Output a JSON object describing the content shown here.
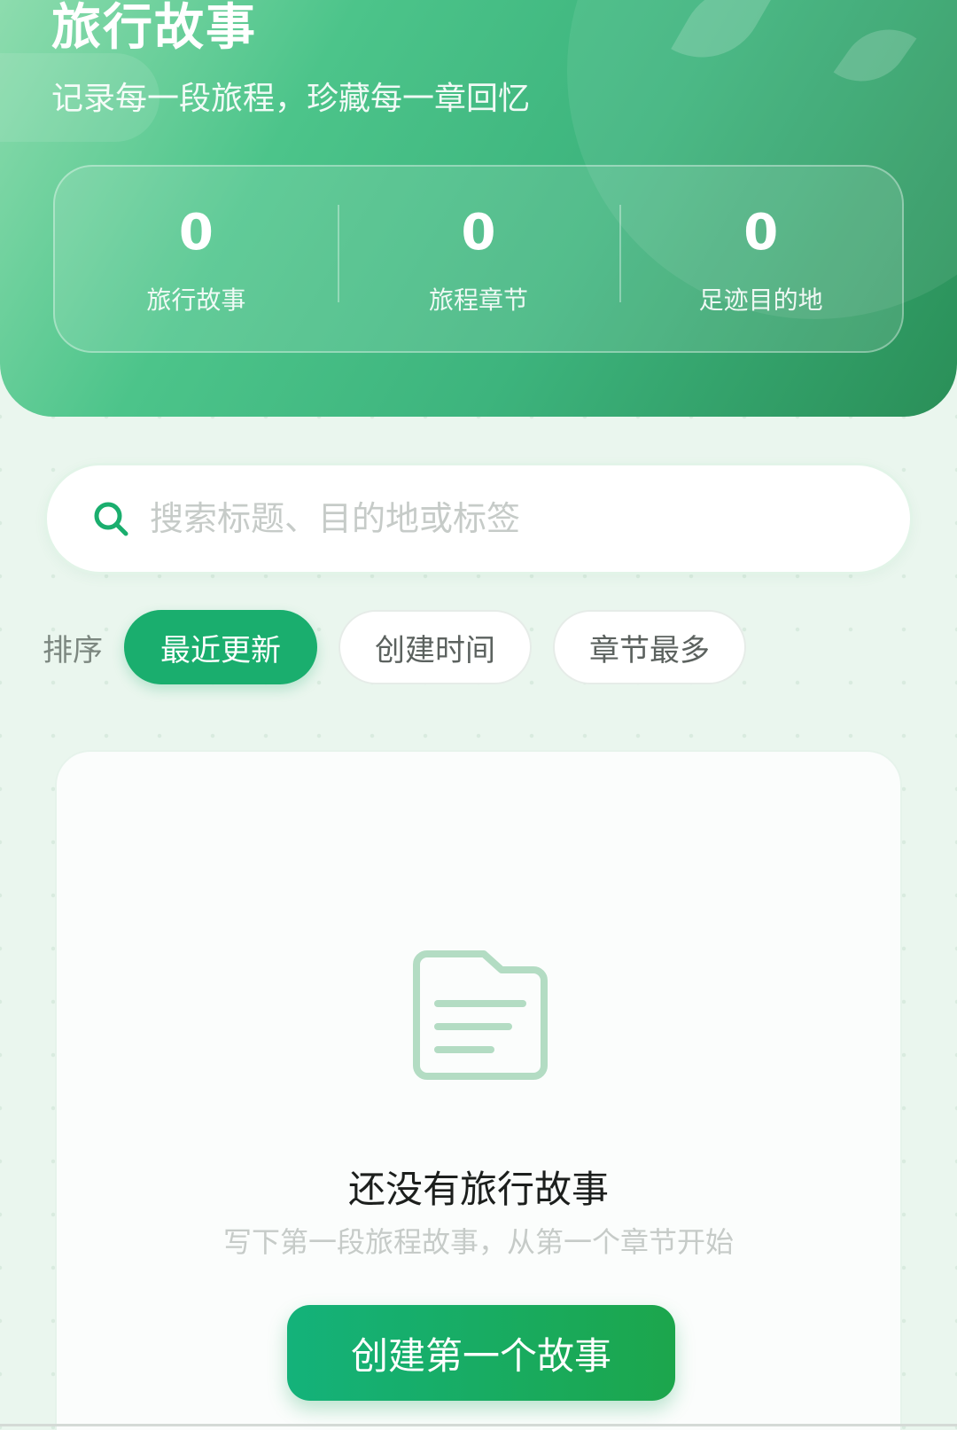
{
  "hero": {
    "title": "旅行故事",
    "subtitle": "记录每一段旅程，珍藏每一章回忆",
    "stats": [
      {
        "value": "0",
        "label": "旅行故事"
      },
      {
        "value": "0",
        "label": "旅程章节"
      },
      {
        "value": "0",
        "label": "足迹目的地"
      }
    ]
  },
  "search": {
    "value": "",
    "placeholder": "搜索标题、目的地或标签",
    "icon": "search-icon"
  },
  "sort": {
    "label": "排序",
    "options": [
      {
        "label": "最近更新",
        "active": true
      },
      {
        "label": "创建时间",
        "active": false
      },
      {
        "label": "章节最多",
        "active": false
      }
    ]
  },
  "empty": {
    "icon": "document-folder-icon",
    "title": "还没有旅行故事",
    "description": "写下第一段旅程故事，从第一个章节开始",
    "button_label": "创建第一个故事"
  },
  "colors": {
    "accent": "#1aae6e",
    "hero_start": "#8ddcae",
    "hero_end": "#2a8f58",
    "icon_tint": "#b3dcc3"
  }
}
